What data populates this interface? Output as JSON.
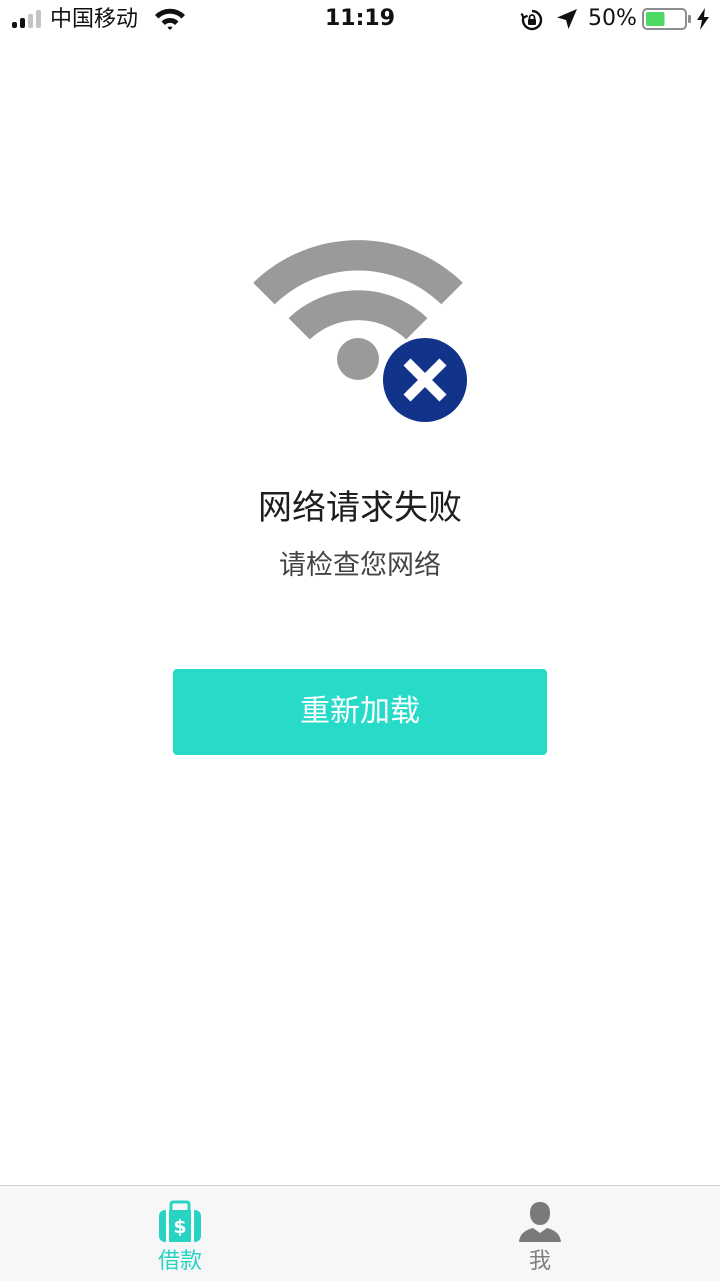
{
  "status_bar": {
    "carrier": "中国移动",
    "time": "11:19",
    "battery_percent": "50%",
    "battery_level": 0.5,
    "signal_bars_active": 2,
    "signal_bars_total": 4,
    "icons": [
      "signal-icon",
      "wifi-icon",
      "orientation-lock-icon",
      "location-icon",
      "battery-icon",
      "charging-icon"
    ]
  },
  "error": {
    "icon": "wifi-off-icon",
    "title": "网络请求失败",
    "subtitle": "请检查您网络"
  },
  "reload_button": {
    "label": "重新加载"
  },
  "tab_bar": {
    "tabs": [
      {
        "label": "借款",
        "icon": "wallet-icon",
        "active": true
      },
      {
        "label": "我",
        "icon": "profile-icon",
        "active": false
      }
    ]
  },
  "colors": {
    "accent": "#28dbc8",
    "tab_active": "#28d3c4",
    "tab_inactive": "#808080",
    "error_badge": "#12338a",
    "wifi_gray": "#9a9a9a",
    "battery_fill": "#4cd964"
  }
}
